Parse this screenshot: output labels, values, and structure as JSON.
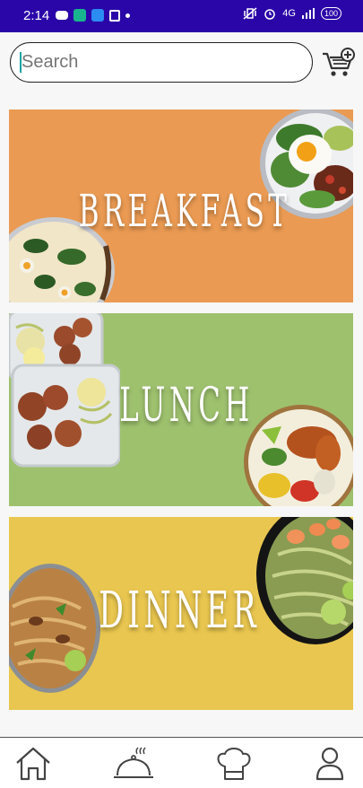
{
  "status_bar": {
    "time": "2:14",
    "network": "4G",
    "battery": "100"
  },
  "search": {
    "placeholder": "Search"
  },
  "categories": [
    {
      "title": "BREAKFAST",
      "color": "#ea9a52"
    },
    {
      "title": "LUNCH",
      "color": "#9ec16e"
    },
    {
      "title": "DINNER",
      "color": "#e9c64f"
    }
  ],
  "bottom_nav": [
    {
      "icon": "home-icon"
    },
    {
      "icon": "cloche-icon"
    },
    {
      "icon": "chef-hat-icon"
    },
    {
      "icon": "user-icon"
    }
  ],
  "colors": {
    "status_bar": "#2a06a8",
    "background": "#f7f7f7"
  }
}
